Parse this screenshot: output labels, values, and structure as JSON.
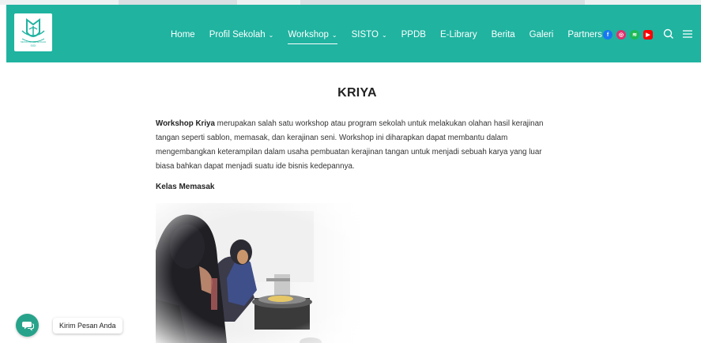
{
  "header": {
    "logo_text": "SEKOLAH MENENGAH",
    "logo_subtext": "SIGI",
    "brand_color": "#1fb3a0"
  },
  "nav": {
    "items": [
      {
        "label": "Home",
        "dropdown": false
      },
      {
        "label": "Profil Sekolah",
        "dropdown": true
      },
      {
        "label": "Workshop",
        "dropdown": true,
        "active": true
      },
      {
        "label": "SISTO",
        "dropdown": true
      },
      {
        "label": "PPDB",
        "dropdown": false
      },
      {
        "label": "E-Library",
        "dropdown": false
      },
      {
        "label": "Berita",
        "dropdown": false
      },
      {
        "label": "Galeri",
        "dropdown": false
      },
      {
        "label": "Partners",
        "dropdown": true
      }
    ],
    "chevron": "⌄"
  },
  "socials": [
    {
      "name": "facebook-icon",
      "glyph": "f"
    },
    {
      "name": "instagram-icon",
      "glyph": "◎"
    },
    {
      "name": "spotify-icon",
      "glyph": "≋"
    },
    {
      "name": "youtube-icon",
      "glyph": "▶"
    }
  ],
  "page": {
    "title": "KRIYA",
    "intro_bold": "Workshop Kriya",
    "intro_rest": " merupakan salah satu workshop atau program sekolah untuk melakukan olahan hasil kerajinan tangan seperti sablon, memasak, dan kerajinan seni. Workshop ini diharapkan dapat membantu dalam mengembangkan keterampilan dalam usaha pembuatan kerajinan tangan untuk menjadi sebuah karya yang luar biasa bahkan dapat menjadi suatu ide bisnis kedepannya.",
    "subheading": "Kelas Memasak"
  },
  "chat": {
    "label": "Kirim Pesan Anda"
  }
}
